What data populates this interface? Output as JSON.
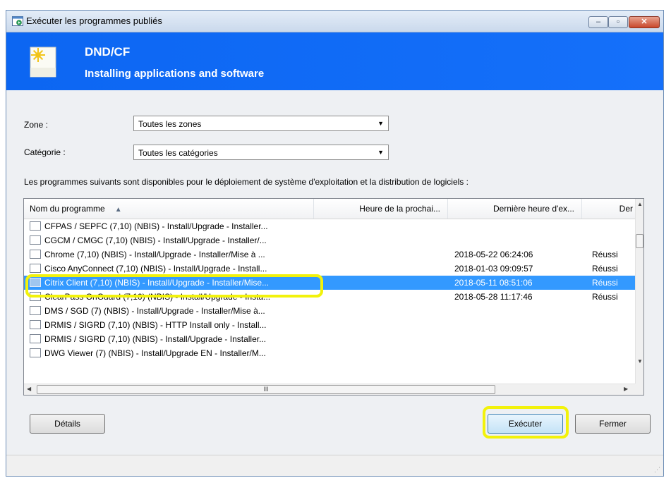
{
  "window": {
    "title": "Exécuter les programmes publiés",
    "controls": {
      "minimize": "‒",
      "maximize": "▫",
      "close": "✕"
    }
  },
  "banner": {
    "title": "DND/CF",
    "subtitle": "Installing applications and software"
  },
  "filters": {
    "zone_label": "Zone :",
    "zone_value": "Toutes les zones",
    "category_label": "Catégorie :",
    "category_value": "Toutes les catégories"
  },
  "description": "Les programmes suivants sont disponibles pour le déploiement de système d'exploitation et la distribution de logiciels :",
  "table": {
    "columns": [
      "Nom du programme",
      "Heure de la prochai...",
      "Dernière heure d'ex...",
      "Der"
    ],
    "rows": [
      {
        "name": "CFPAS / SEPFC (7,10) (NBIS) - Install/Upgrade - Installer...",
        "next": "",
        "last": "",
        "status": ""
      },
      {
        "name": "CGCM / CMGC (7,10) (NBIS) - Install/Upgrade - Installer/...",
        "next": "",
        "last": "",
        "status": ""
      },
      {
        "name": "Chrome (7,10) (NBIS) - Install/Upgrade - Installer/Mise à ...",
        "next": "",
        "last": "2018-05-22 06:24:06",
        "status": "Réussi"
      },
      {
        "name": "Cisco AnyConnect (7,10) (NBIS) - Install/Upgrade - Install...",
        "next": "",
        "last": "2018-01-03 09:09:57",
        "status": "Réussi"
      },
      {
        "name": "Citrix Client (7,10) (NBIS) - Install/Upgrade - Installer/Mise...",
        "next": "",
        "last": "2018-05-11 08:51:06",
        "status": "Réussi",
        "selected": true
      },
      {
        "name": "ClearPass OnGuard (7,10) (NBIS) - Install/Upgrade - Insta...",
        "next": "",
        "last": "2018-05-28 11:17:46",
        "status": "Réussi"
      },
      {
        "name": "DMS / SGD (7) (NBIS) - Install/Upgrade - Installer/Mise à...",
        "next": "",
        "last": "",
        "status": ""
      },
      {
        "name": "DRMIS / SIGRD (7,10) (NBIS) - HTTP Install only - Install...",
        "next": "",
        "last": "",
        "status": ""
      },
      {
        "name": "DRMIS / SIGRD (7,10) (NBIS) - Install/Upgrade - Installer...",
        "next": "",
        "last": "",
        "status": ""
      },
      {
        "name": "DWG Viewer (7) (NBIS) - Install/Upgrade EN - Installer/M...",
        "next": "",
        "last": "",
        "status": ""
      }
    ],
    "hscroll_grip": "III"
  },
  "buttons": {
    "details": "Détails",
    "run": "Exécuter",
    "close": "Fermer"
  },
  "colors": {
    "banner": "#0c66f2",
    "selection": "#3399ff",
    "highlight": "#f2f20b"
  }
}
